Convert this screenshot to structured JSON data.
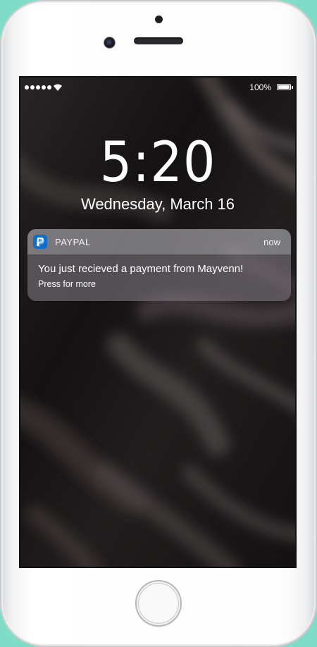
{
  "status_bar": {
    "battery_label": "100%",
    "battery_level": 1.0,
    "signal_bars": 5
  },
  "lock_screen": {
    "time": "5:20",
    "date": "Wednesday, March 16"
  },
  "notification": {
    "app_name": "PAYPAL",
    "time_ago": "now",
    "message": "You just recieved a payment from Mayvenn!",
    "hint": "Press for more",
    "icon": "paypal-icon",
    "icon_color": "#0f6ec7"
  },
  "colors": {
    "background": "#7fdcc6",
    "phone_body": "#ffffff"
  }
}
